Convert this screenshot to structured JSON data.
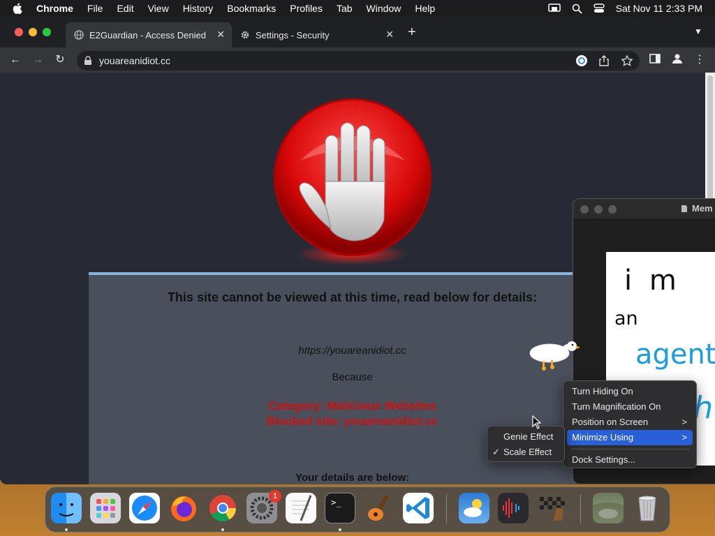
{
  "menubar": {
    "app_name": "Chrome",
    "items": [
      "File",
      "Edit",
      "View",
      "History",
      "Bookmarks",
      "Profiles",
      "Tab",
      "Window",
      "Help"
    ],
    "clock": "Sat Nov 11  2:33 PM"
  },
  "browser": {
    "tabs": [
      {
        "label": "E2Guardian - Access Denied",
        "icon": "globe-icon",
        "active": true
      },
      {
        "label": "Settings - Security",
        "icon": "gear-icon",
        "active": false
      }
    ],
    "new_tab": "+",
    "url": "youareanidiot.cc"
  },
  "page": {
    "heading": "This site cannot be viewed at this time, read below for details:",
    "blocked_url": "https://youareanidiot.cc",
    "because": "Because",
    "category": "Category: Malicious Websites",
    "blocked_site": "Blocked site: youareanidiot.cc",
    "details": "Your details are below:",
    "accent_color": "#d01010"
  },
  "memo": {
    "title": "Mem",
    "lines": [
      "i m",
      "an",
      "agent",
      "th"
    ]
  },
  "dock_menu": {
    "items": [
      {
        "label": "Turn Hiding On"
      },
      {
        "label": "Turn Magnification On"
      },
      {
        "label": "Position on Screen",
        "submenu": true
      },
      {
        "label": "Minimize Using",
        "submenu": true,
        "highlighted": true
      },
      {
        "label": "Dock Settings..."
      }
    ],
    "submenu": [
      {
        "label": "Genie Effect",
        "checked": false
      },
      {
        "label": "Scale Effect",
        "checked": true
      }
    ],
    "check": "✓",
    "arrow": ">"
  },
  "dock": {
    "apps": [
      "Finder",
      "Launchpad",
      "Safari",
      "Firefox",
      "Chrome",
      "System Settings",
      "TextEdit",
      "Terminal",
      "GarageBand",
      "Visual Studio Code",
      "Weather",
      "Audio App",
      "Chess",
      "Preview",
      "Trash"
    ],
    "settings_badge": "1"
  }
}
